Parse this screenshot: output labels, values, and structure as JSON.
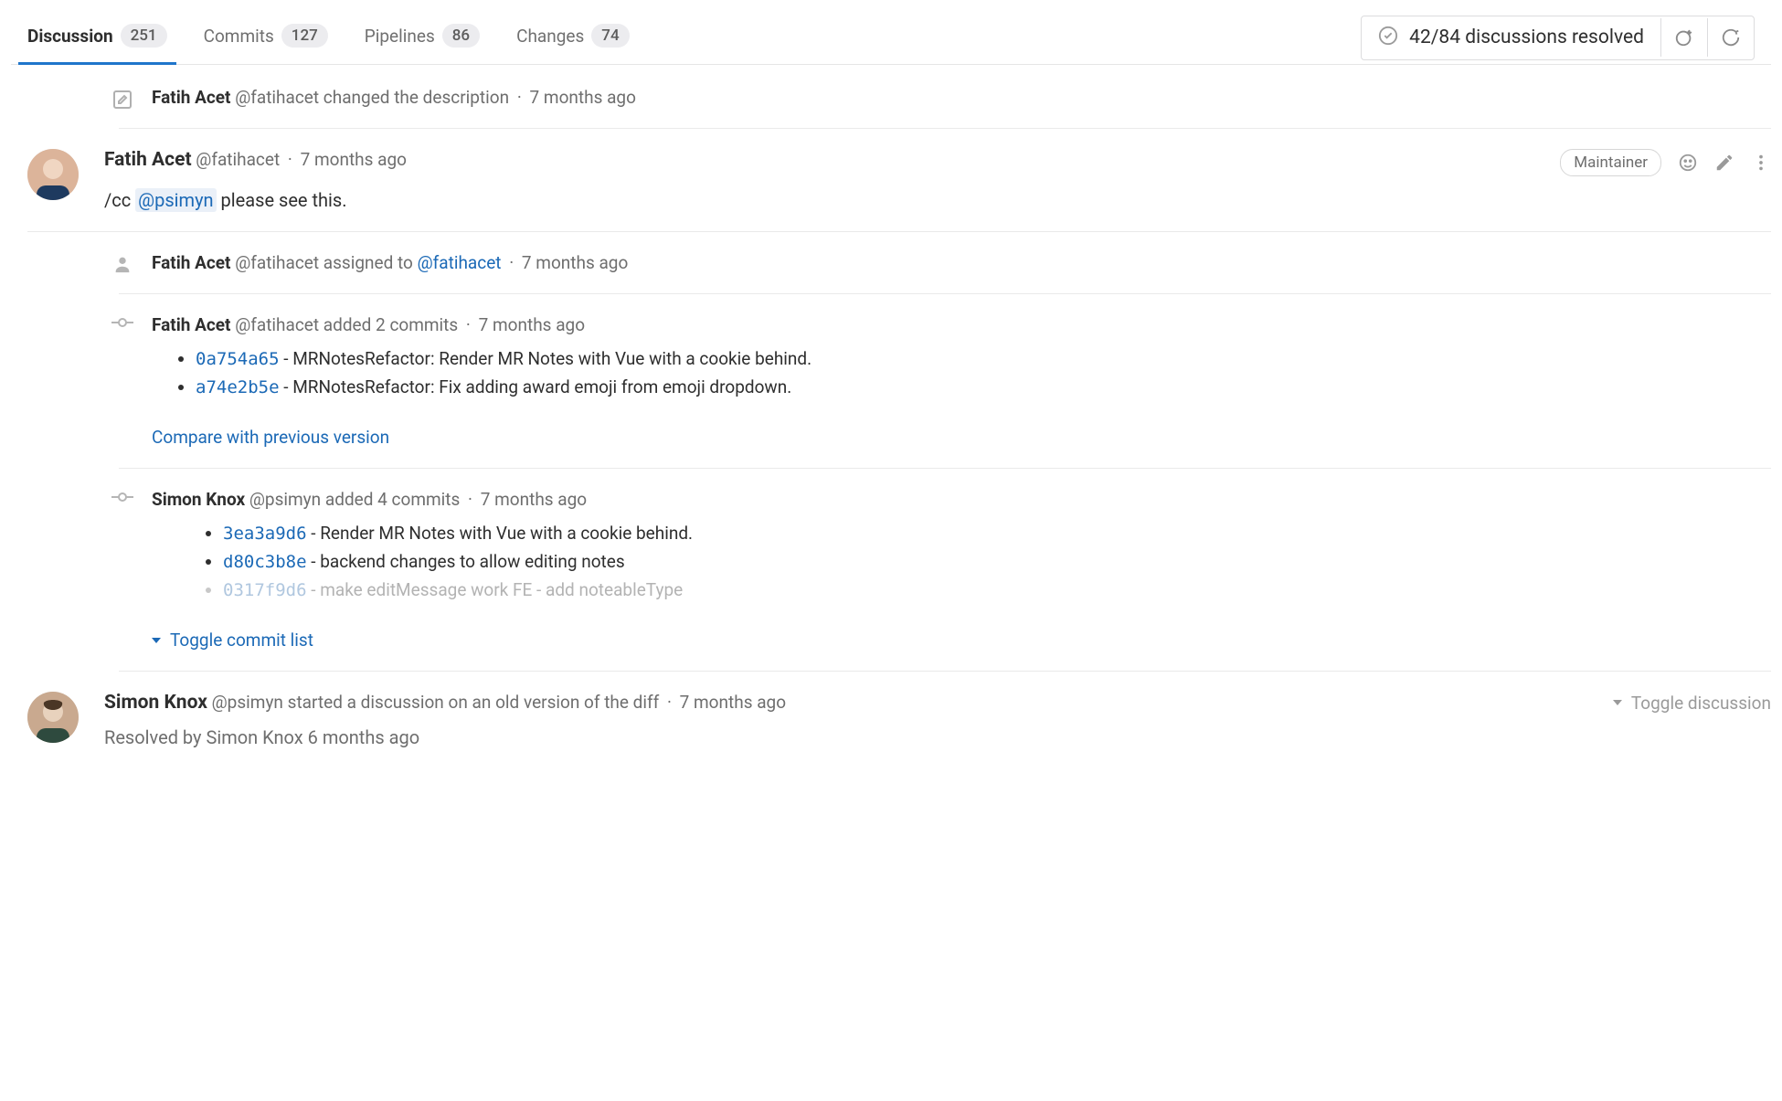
{
  "tabs": {
    "discussion": {
      "label": "Discussion",
      "count": "251"
    },
    "commits": {
      "label": "Commits",
      "count": "127"
    },
    "pipelines": {
      "label": "Pipelines",
      "count": "86"
    },
    "changes": {
      "label": "Changes",
      "count": "74"
    }
  },
  "resolved": {
    "text": "42/84 discussions resolved"
  },
  "events": {
    "desc_change": {
      "author": "Fatih Acet",
      "handle": "@fatihacet",
      "action": "changed the description",
      "time": "7 months ago"
    },
    "comment1": {
      "author": "Fatih Acet",
      "handle": "@fatihacet",
      "time": "7 months ago",
      "role": "Maintainer",
      "body_prefix": "/cc ",
      "mention": "@psimyn",
      "body_suffix": " please see this."
    },
    "assign": {
      "author": "Fatih Acet",
      "handle": "@fatihacet",
      "action": "assigned to",
      "assignee": "@fatihacet",
      "time": "7 months ago"
    },
    "commits1": {
      "author": "Fatih Acet",
      "handle": "@fatihacet",
      "action": "added 2 commits",
      "time": "7 months ago",
      "items": [
        {
          "hash": "0a754a65",
          "msg": "MRNotesRefactor: Render MR Notes with Vue with a cookie behind."
        },
        {
          "hash": "a74e2b5e",
          "msg": "MRNotesRefactor: Fix adding award emoji from emoji dropdown."
        }
      ],
      "compare": "Compare with previous version"
    },
    "commits2": {
      "author": "Simon Knox",
      "handle": "@psimyn",
      "action": "added 4 commits",
      "time": "7 months ago",
      "items": [
        {
          "hash": "3ea3a9d6",
          "msg": "Render MR Notes with Vue with a cookie behind."
        },
        {
          "hash": "d80c3b8e",
          "msg": "backend changes to allow editing notes"
        },
        {
          "hash": "0317f9d6",
          "msg": "make editMessage work FE - add noteableType",
          "faded": true
        }
      ],
      "toggle": "Toggle commit list"
    },
    "discussion": {
      "author": "Simon Knox",
      "handle": "@psimyn",
      "action": "started a discussion on an old version of the diff",
      "time": "7 months ago",
      "toggle": "Toggle discussion",
      "resolved": "Resolved by Simon Knox 6 months ago"
    }
  }
}
